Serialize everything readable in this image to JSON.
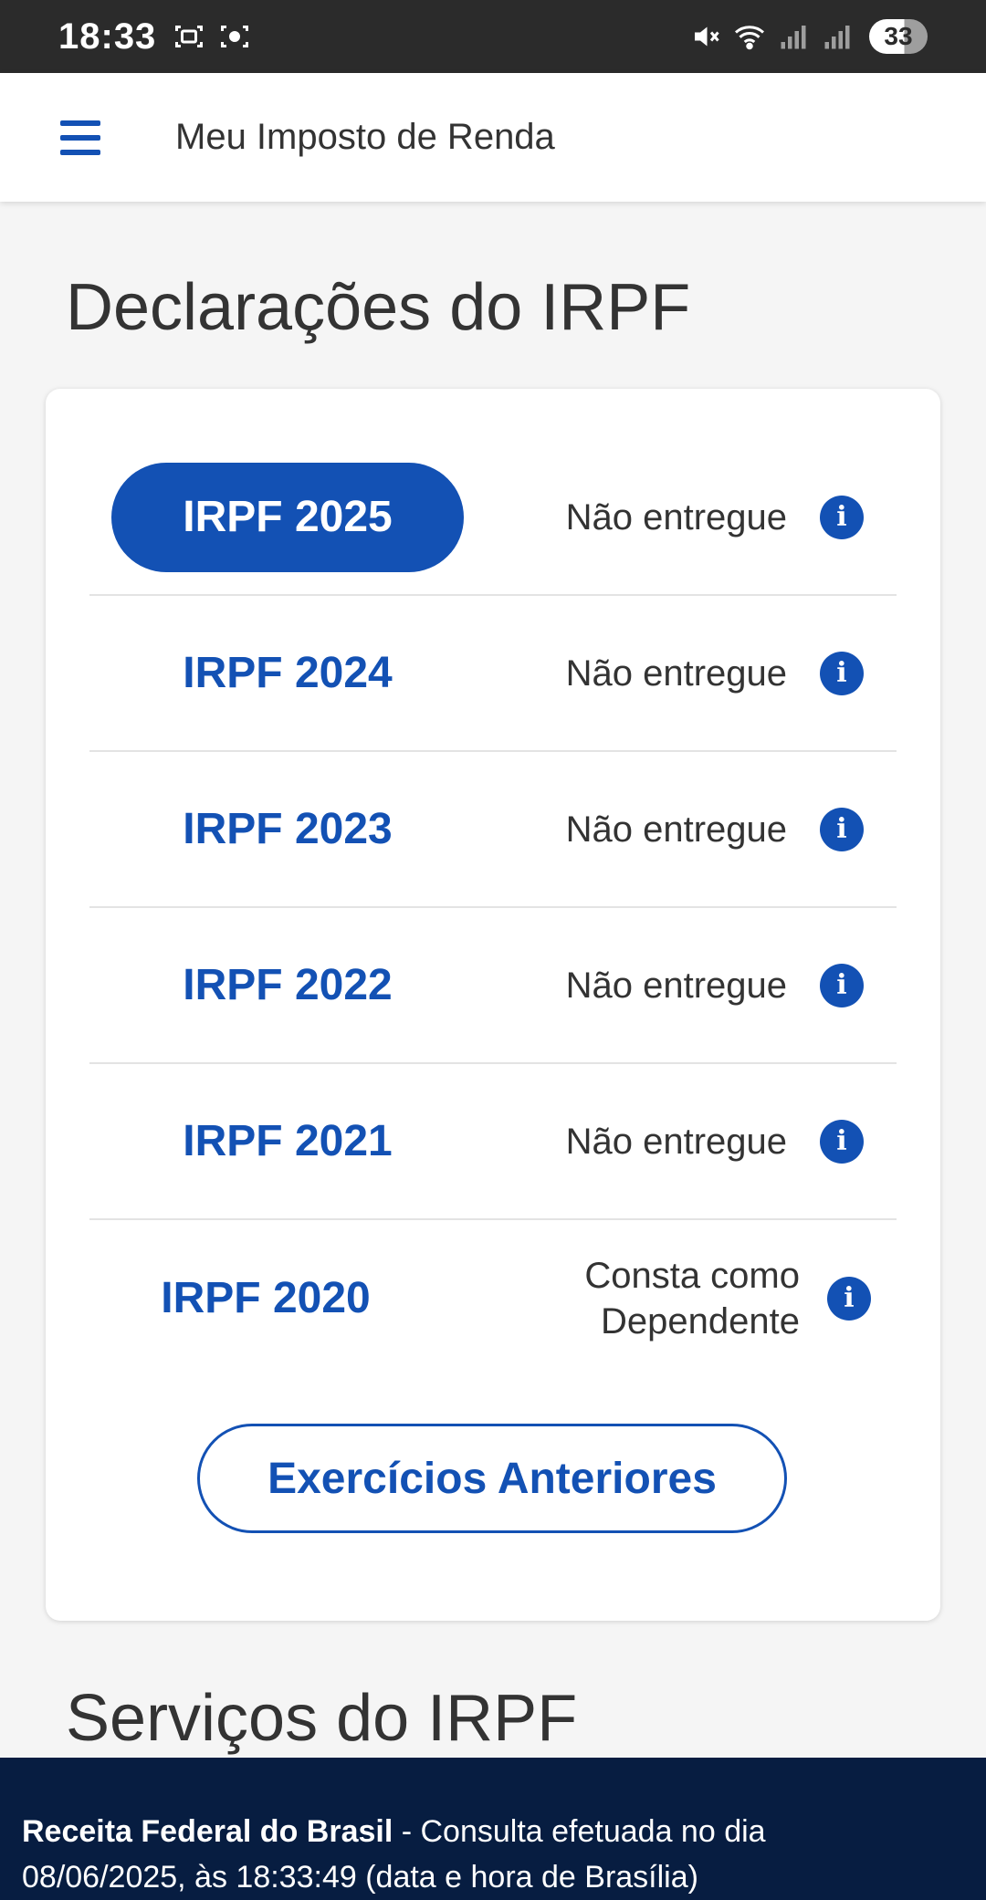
{
  "status_bar": {
    "time": "18:33",
    "icons": [
      "screenshot-icon",
      "screen-record-icon",
      "mute-icon",
      "wifi-icon",
      "signal-icon",
      "signal-icon"
    ],
    "battery": "33"
  },
  "app_bar": {
    "title": "Meu Imposto de Renda"
  },
  "declarations": {
    "title": "Declarações do IRPF",
    "rows": [
      {
        "year": "IRPF 2025",
        "status": "Não entregue",
        "active": true
      },
      {
        "year": "IRPF 2024",
        "status": "Não entregue"
      },
      {
        "year": "IRPF 2023",
        "status": "Não entregue"
      },
      {
        "year": "IRPF 2022",
        "status": "Não entregue"
      },
      {
        "year": "IRPF 2021",
        "status": "Não entregue"
      },
      {
        "year": "IRPF 2020",
        "status_line1": "Consta como",
        "status_line2": "Dependente"
      }
    ],
    "info_glyph": "i",
    "previous_button": "Exercícios Anteriores"
  },
  "services": {
    "title": "Serviços do IRPF"
  },
  "footer": {
    "org": "Receita Federal do Brasil",
    "separator": " - ",
    "text_1": "Consulta efetuada no dia",
    "text_2": "08/06/2025, às 18:33:49 (data e hora de Brasília)"
  },
  "colors": {
    "primary": "#1351b4",
    "footer_bg": "#071d41",
    "status_bar_bg": "#2b2b2b",
    "page_bg": "#f5f5f5"
  }
}
